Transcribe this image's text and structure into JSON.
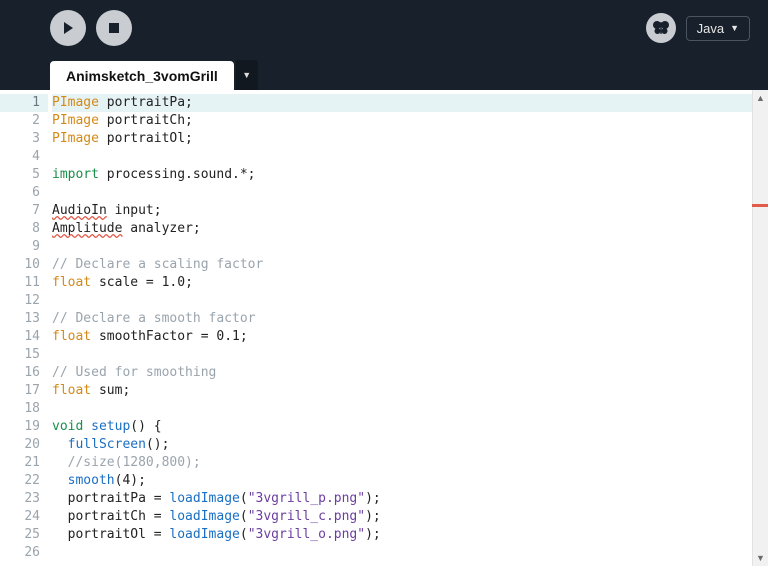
{
  "toolbar": {
    "run_label": "Run",
    "stop_label": "Stop",
    "lang_label": "Java"
  },
  "tab": {
    "name": "Animsketch_3vomGrill"
  },
  "editor": {
    "lines": [
      {
        "n": 1,
        "hl": true,
        "tokens": [
          [
            "t-type",
            "PImage"
          ],
          [
            "",
            " portraitPa;"
          ]
        ]
      },
      {
        "n": 2,
        "tokens": [
          [
            "t-type",
            "PImage"
          ],
          [
            "",
            " portraitCh;"
          ]
        ]
      },
      {
        "n": 3,
        "tokens": [
          [
            "t-type",
            "PImage"
          ],
          [
            "",
            " portraitOl;"
          ]
        ]
      },
      {
        "n": 4,
        "tokens": []
      },
      {
        "n": 5,
        "tokens": [
          [
            "t-green",
            "import"
          ],
          [
            "",
            " processing.sound.*;"
          ]
        ]
      },
      {
        "n": 6,
        "tokens": []
      },
      {
        "n": 7,
        "tokens": [
          [
            "t-warn",
            "AudioIn"
          ],
          [
            "",
            " input;"
          ]
        ]
      },
      {
        "n": 8,
        "tokens": [
          [
            "t-warn",
            "Amplitude"
          ],
          [
            "",
            " analyzer;"
          ]
        ]
      },
      {
        "n": 9,
        "tokens": []
      },
      {
        "n": 10,
        "tokens": [
          [
            "t-cmt",
            "// Declare a scaling factor"
          ]
        ]
      },
      {
        "n": 11,
        "tokens": [
          [
            "t-type",
            "float"
          ],
          [
            "",
            " scale = "
          ],
          [
            "t-num",
            "1.0"
          ],
          [
            "",
            ";"
          ]
        ]
      },
      {
        "n": 12,
        "tokens": []
      },
      {
        "n": 13,
        "tokens": [
          [
            "t-cmt",
            "// Declare a smooth factor"
          ]
        ]
      },
      {
        "n": 14,
        "tokens": [
          [
            "t-type",
            "float"
          ],
          [
            "",
            " smoothFactor = "
          ],
          [
            "t-num",
            "0.1"
          ],
          [
            "",
            ";"
          ]
        ]
      },
      {
        "n": 15,
        "tokens": []
      },
      {
        "n": 16,
        "tokens": [
          [
            "t-cmt",
            "// Used for smoothing"
          ]
        ]
      },
      {
        "n": 17,
        "tokens": [
          [
            "t-type",
            "float"
          ],
          [
            "",
            " sum;"
          ]
        ]
      },
      {
        "n": 18,
        "tokens": []
      },
      {
        "n": 19,
        "tokens": [
          [
            "t-green",
            "void"
          ],
          [
            "",
            " "
          ],
          [
            "t-fn",
            "setup"
          ],
          [
            "",
            "() {"
          ]
        ]
      },
      {
        "n": 20,
        "tokens": [
          [
            "",
            "  "
          ],
          [
            "t-fn",
            "fullScreen"
          ],
          [
            "",
            "();"
          ]
        ]
      },
      {
        "n": 21,
        "tokens": [
          [
            "",
            "  "
          ],
          [
            "t-cmt",
            "//size(1280,800);"
          ]
        ]
      },
      {
        "n": 22,
        "tokens": [
          [
            "",
            "  "
          ],
          [
            "t-fn",
            "smooth"
          ],
          [
            "",
            "("
          ],
          [
            "t-num",
            "4"
          ],
          [
            "",
            ");"
          ]
        ]
      },
      {
        "n": 23,
        "tokens": [
          [
            "",
            "  portraitPa = "
          ],
          [
            "t-fn",
            "loadImage"
          ],
          [
            "",
            "("
          ],
          [
            "t-str",
            "\"3vgrill_p.png\""
          ],
          [
            "",
            ");"
          ]
        ]
      },
      {
        "n": 24,
        "tokens": [
          [
            "",
            "  portraitCh = "
          ],
          [
            "t-fn",
            "loadImage"
          ],
          [
            "",
            "("
          ],
          [
            "t-str",
            "\"3vgrill_c.png\""
          ],
          [
            "",
            ");"
          ]
        ]
      },
      {
        "n": 25,
        "tokens": [
          [
            "",
            "  portraitOl = "
          ],
          [
            "t-fn",
            "loadImage"
          ],
          [
            "",
            "("
          ],
          [
            "t-str",
            "\"3vgrill_o.png\""
          ],
          [
            "",
            ");"
          ]
        ]
      },
      {
        "n": 26,
        "tokens": []
      }
    ]
  }
}
